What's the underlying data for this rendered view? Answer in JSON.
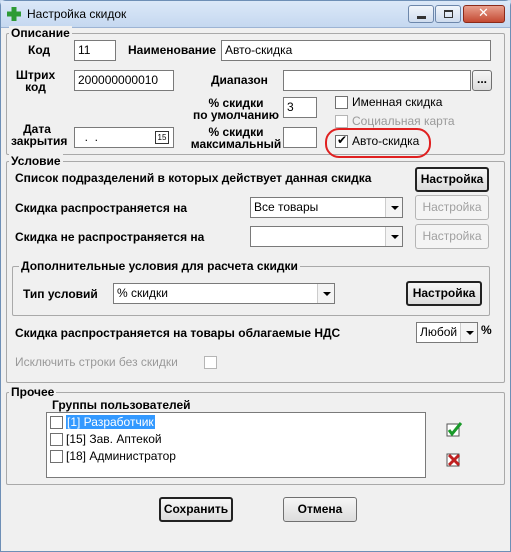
{
  "window": {
    "title": "Настройка скидок"
  },
  "description": {
    "group_title": "Описание",
    "code_label": "Код",
    "code_value": "11",
    "name_label": "Наименование",
    "name_value": "Авто-скидка",
    "barcode_label_line1": "Штрих",
    "barcode_label_line2": "код",
    "barcode_value": "200000000010",
    "range_label": "Диапазон",
    "range_value": "",
    "range_button": "...",
    "default_discount_label_line1": "% скидки",
    "default_discount_label_line2": "по умолчанию",
    "default_discount_value": "3",
    "max_discount_label_line1": "% скидки",
    "max_discount_label_line2": "максимальный",
    "max_discount_value": "",
    "close_date_label_line1": "Дата",
    "close_date_label_line2": "закрытия",
    "close_date_value": "  .  .",
    "calendar_icon_text": "15",
    "named_discount_label": "Именная скидка",
    "named_discount_checked": false,
    "social_card_label": "Социальная карта",
    "social_card_checked": false,
    "auto_discount_label": "Авто-скидка",
    "auto_discount_checked": true
  },
  "condition": {
    "group_title": "Условие",
    "departments_label": "Список подразделений в которых действует данная скидка",
    "departments_button": "Настройка",
    "applies_to_label": "Скидка распространяется на",
    "applies_to_value": "Все товары",
    "applies_to_button": "Настройка",
    "not_applies_to_label": "Скидка не распространяется на",
    "not_applies_to_value": "",
    "not_applies_to_button": "Настройка",
    "extra_group_title": "Дополнительные условия для расчета  скидки",
    "condition_type_label": "Тип условий",
    "condition_type_value": "% скидки",
    "condition_type_button": "Настройка",
    "vat_label": "Скидка распространяется  на товары облагаемые НДС",
    "vat_value": "Любой",
    "vat_suffix": "%",
    "exclude_label": "Исключить строки без скидки",
    "exclude_checked": false
  },
  "other": {
    "group_title": "Прочее",
    "user_groups_title": "Группы пользователей",
    "user_groups": [
      {
        "label": "[1] Разработчик",
        "checked": false,
        "selected": true
      },
      {
        "label": "[15] Зав. Аптекой",
        "checked": false,
        "selected": false
      },
      {
        "label": "[18] Администратор",
        "checked": false,
        "selected": false
      }
    ]
  },
  "footer": {
    "save_label": "Сохранить",
    "cancel_label": "Отмена"
  },
  "colors": {
    "selection": "#3399ff",
    "highlight_ring": "#e02020",
    "check_icon": "#1a9a2a",
    "uncheck_icon": "#c02020"
  }
}
